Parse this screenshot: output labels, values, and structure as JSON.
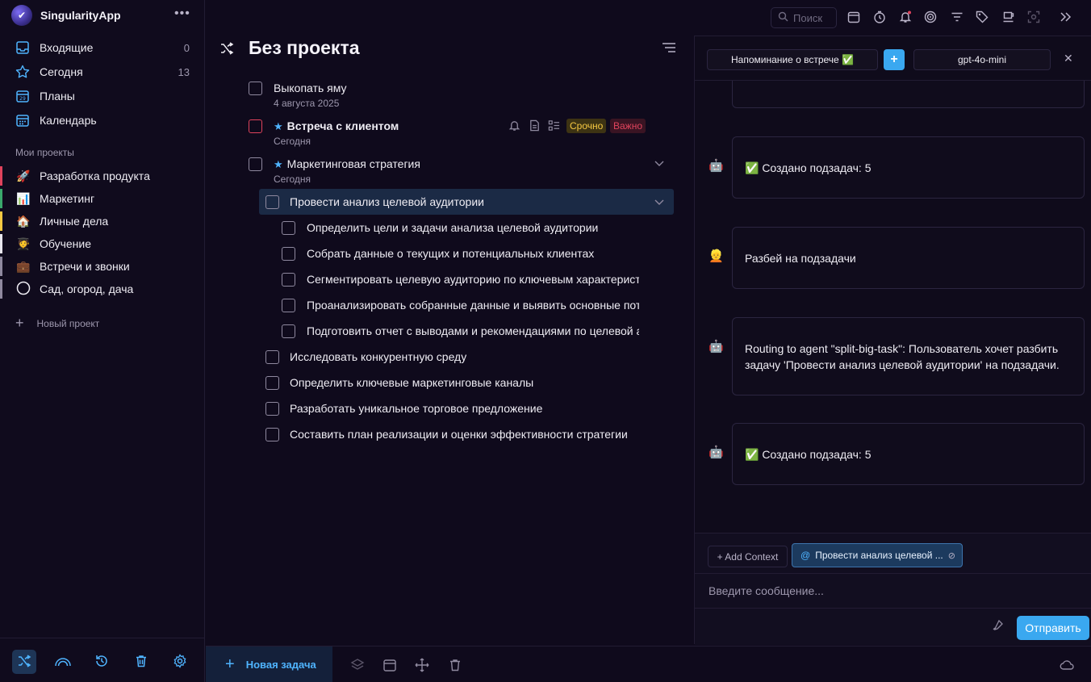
{
  "app": {
    "name": "SingularityApp",
    "more_icon": "more-dots-icon"
  },
  "colors": {
    "accent": "#3aa8f0",
    "urgent_tag": "#f5c842",
    "important_tag": "#e0435c",
    "background": "#0f0a1c"
  },
  "sidebar": {
    "nav": [
      {
        "label": "Входящие",
        "count": "0",
        "icon": "inbox-icon"
      },
      {
        "label": "Сегодня",
        "count": "13",
        "icon": "star-icon"
      },
      {
        "label": "Планы",
        "count": "",
        "icon": "plans-calendar-icon"
      },
      {
        "label": "Календарь",
        "count": "",
        "icon": "calendar-icon"
      }
    ],
    "projects_title": "Мои проекты",
    "projects": [
      {
        "emoji": "🚀",
        "label": "Разработка продукта",
        "color": "#e0435c"
      },
      {
        "emoji": "📊",
        "label": "Маркетинг",
        "color": "#3aa86b"
      },
      {
        "emoji": "🏠",
        "label": "Личные дела",
        "color": "#f5c842"
      },
      {
        "emoji": "🧑‍🎓",
        "label": "Обучение",
        "color": "#e8e6ee"
      },
      {
        "emoji": "💼",
        "label": "Встречи и звонки",
        "color": "#8f899f"
      },
      {
        "emoji": "",
        "label": "Сад, огород, дача",
        "color": "#8f899f"
      }
    ],
    "new_project": "Новый проект",
    "bottom_icons": [
      "shuffle-icon",
      "rainbow-icon",
      "history-icon",
      "trash-icon",
      "settings-icon"
    ]
  },
  "toolbar": {
    "search_placeholder": "Поиск",
    "icons": [
      "calendar-icon",
      "timer-icon",
      "bell-icon",
      "target-icon",
      "filter-icon",
      "tag-icon",
      "cup-icon",
      "focus-icon",
      "collapse-icon"
    ]
  },
  "main": {
    "title": "Без проекта",
    "tasks": [
      {
        "text": "Выкопать яму",
        "date": "4 августа 2025"
      },
      {
        "text": "Встреча с клиентом",
        "date": "Сегодня",
        "starred": true,
        "tags": [
          "Срочно",
          "Важно"
        ]
      },
      {
        "text": "Маркетинговая стратегия",
        "date": "Сегодня",
        "starred": true
      },
      {
        "text": "Провести анализ целевой аудитории"
      },
      {
        "text": "Определить цели и задачи анализа целевой аудитории"
      },
      {
        "text": "Собрать данные о текущих и потенциальных клиентах"
      },
      {
        "text": "Сегментировать целевую аудиторию по ключевым характеристикам"
      },
      {
        "text": "Проанализировать собранные данные и выявить основные потребности"
      },
      {
        "text": "Подготовить отчет с выводами и рекомендациями по целевой аудитории"
      },
      {
        "text": "Исследовать конкурентную среду"
      },
      {
        "text": "Определить ключевые маркетинговые каналы"
      },
      {
        "text": "Разработать уникальное торговое предложение"
      },
      {
        "text": "Составить план реализации и оценки эффективности стратегии"
      }
    ],
    "new_task": "Новая задача"
  },
  "chat": {
    "reminder_select": "Напоминание о встрече ✅",
    "model_select": "gpt-4o-mini",
    "messages": [
      {
        "role": "bot",
        "avatar": "🤖",
        "text": "✅ Создано подзадач: 5"
      },
      {
        "role": "user",
        "avatar": "👱",
        "text": "Разбей на подзадачи"
      },
      {
        "role": "bot",
        "avatar": "🤖",
        "text": "Routing to agent \"split-big-task\": Пользователь хочет разбить задачу 'Провести анализ целевой аудитории' на подзадачи."
      },
      {
        "role": "bot",
        "avatar": "🤖",
        "text": "✅ Создано подзадач: 5"
      }
    ],
    "add_context": "+ Add Context",
    "context_chip": "Провести анализ целевой ...",
    "input_placeholder": "Введите сообщение...",
    "send": "Отправить"
  }
}
